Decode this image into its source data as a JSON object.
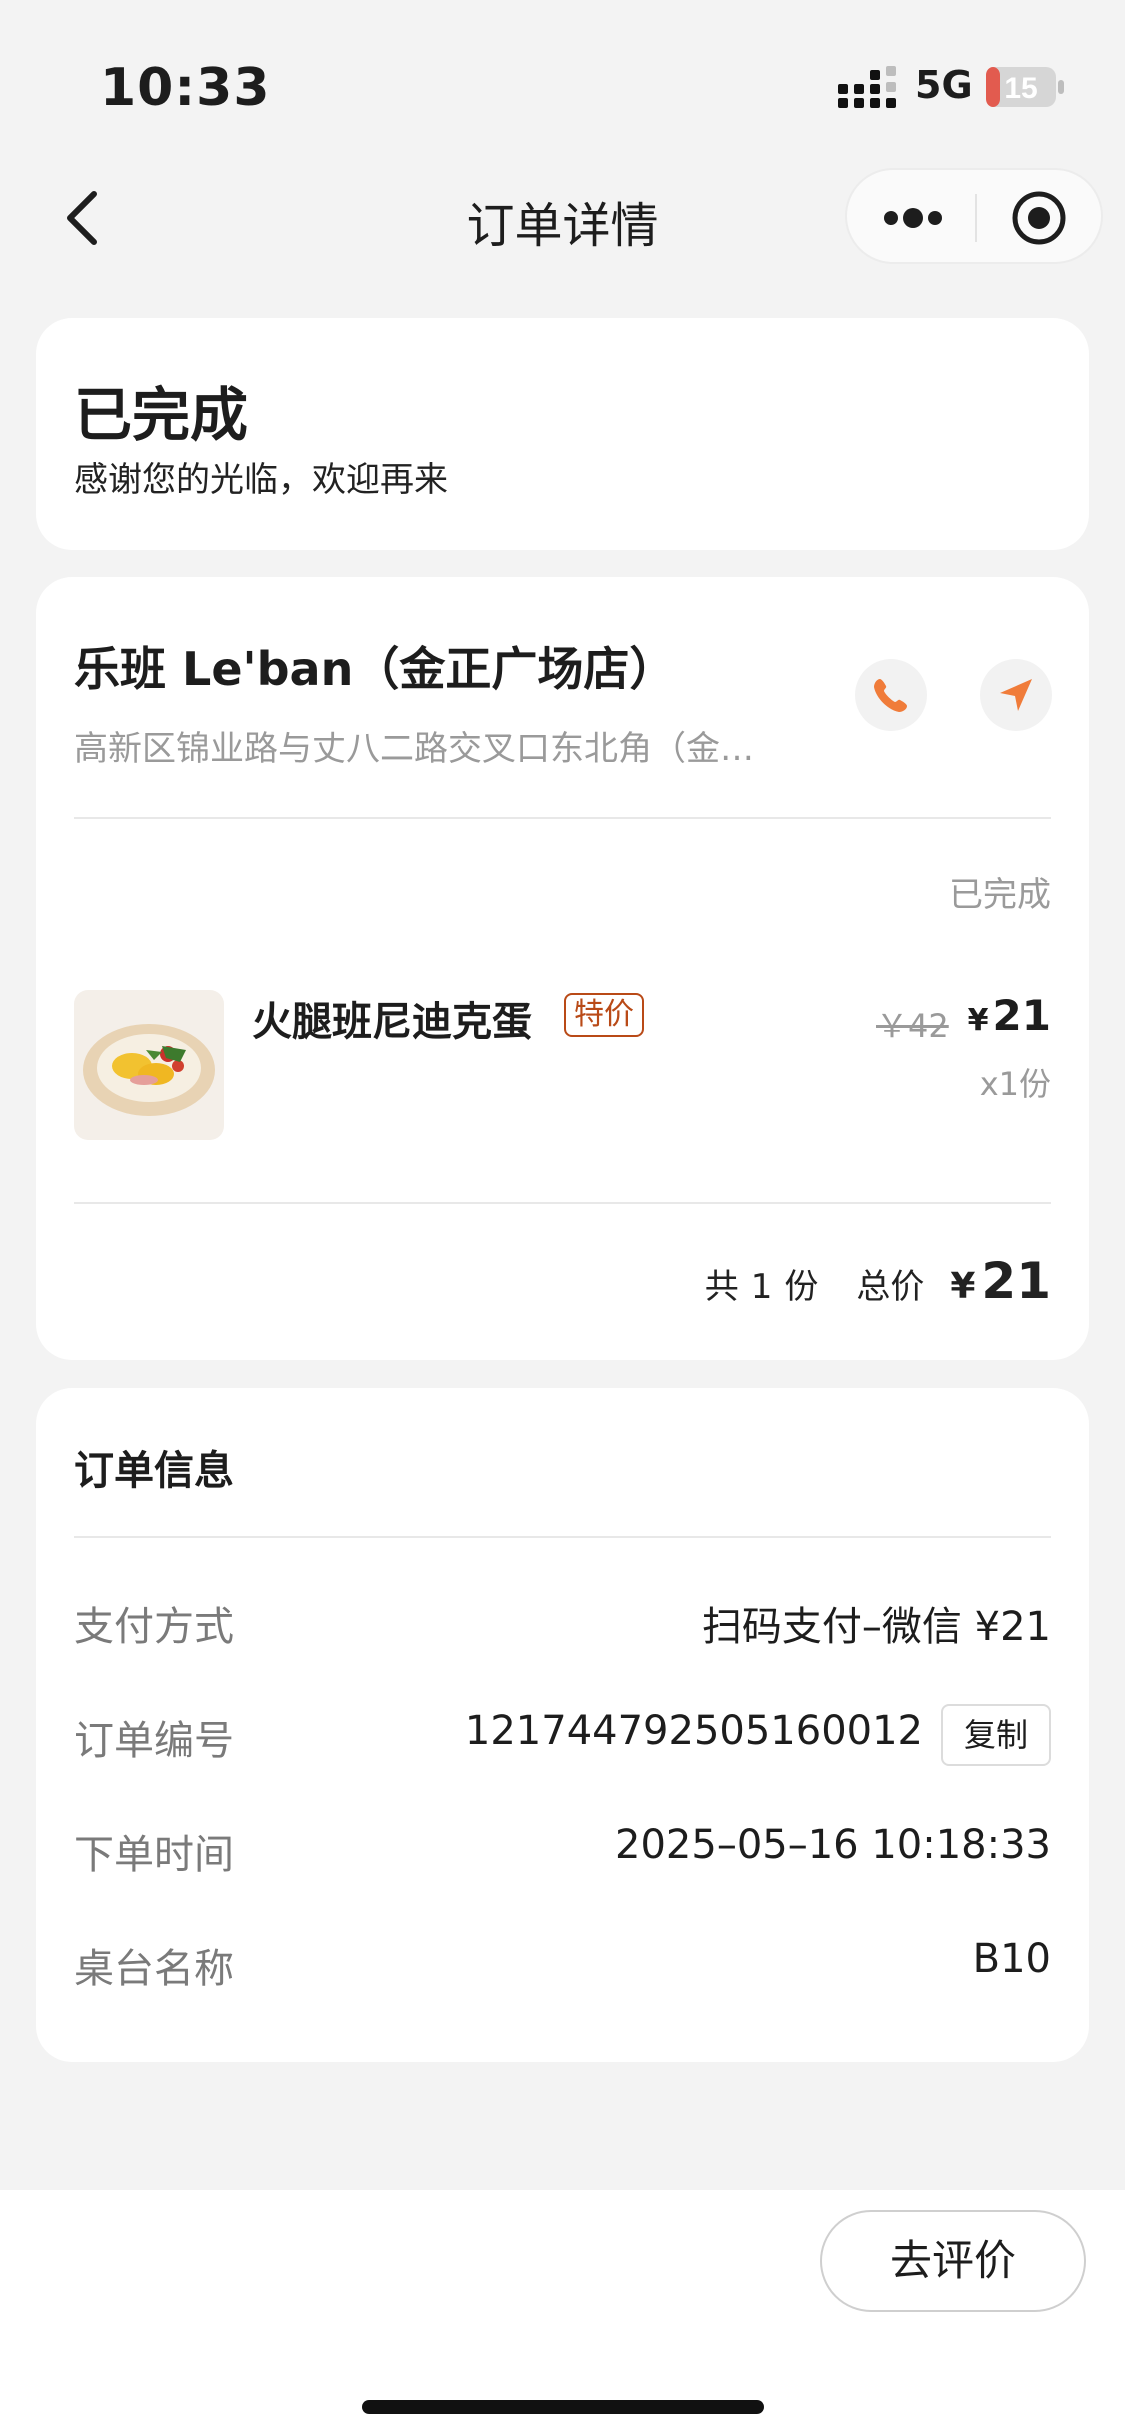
{
  "status_bar": {
    "time": "10:33",
    "network": "5G",
    "battery": "15",
    "battery_color": "#e25b4f"
  },
  "nav": {
    "title": "订单详情",
    "back_icon": "chevron-left-icon",
    "more_icon": "more-dots-icon",
    "close_icon": "target-circle-icon"
  },
  "order_status": {
    "title": "已完成",
    "subtitle": "感谢您的光临，欢迎再来"
  },
  "store": {
    "name": "乐班 Le'ban（金正广场店）",
    "address": "高新区锦业路与丈八二路交叉口东北角（金…",
    "accent_color": "#f07c3a",
    "phone_icon": "phone-icon",
    "navigate_icon": "navigation-arrow-icon"
  },
  "order": {
    "status": "已完成",
    "items": [
      {
        "name": "火腿班尼迪克蛋",
        "tag": "特价",
        "original_price": "￥42",
        "currency": "¥",
        "price": "21",
        "quantity": "x1份"
      }
    ],
    "total_count_label": "共",
    "total_count": "1",
    "total_unit": "份",
    "total_label": "总价",
    "total_currency": "¥",
    "total_value": "21"
  },
  "order_info": {
    "title": "订单信息",
    "payment_label": "支付方式",
    "payment_value": "扫码支付–微信 ¥21",
    "order_no_label": "订单编号",
    "order_no_value": "121744792505160012",
    "copy_label": "复制",
    "order_time_label": "下单时间",
    "order_time_value": "2025–05–16 10:18:33",
    "table_label": "桌台名称",
    "table_value": "B10"
  },
  "bottom": {
    "review_label": "去评价"
  }
}
